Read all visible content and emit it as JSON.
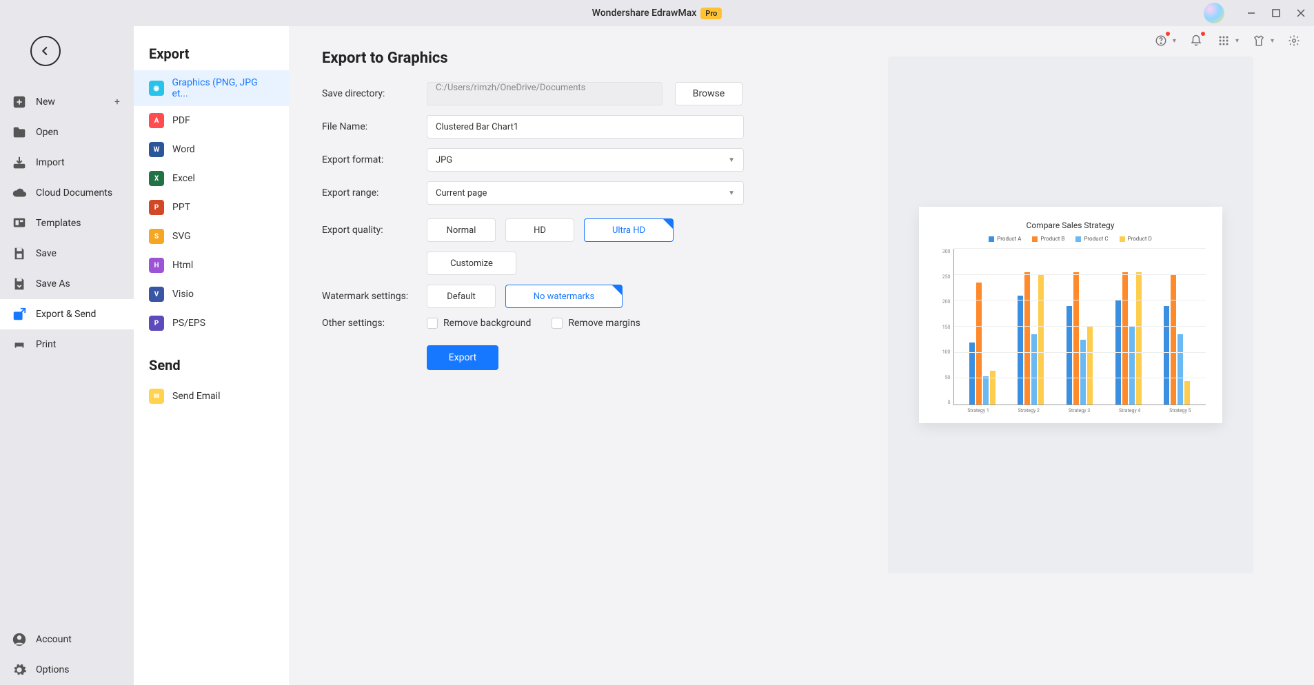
{
  "titlebar": {
    "title": "Wondershare EdrawMax",
    "badge": "Pro"
  },
  "sidebar": {
    "new": "New",
    "open": "Open",
    "import": "Import",
    "cloud": "Cloud Documents",
    "templates": "Templates",
    "save": "Save",
    "saveas": "Save As",
    "exportsend": "Export & Send",
    "print": "Print",
    "account": "Account",
    "options": "Options"
  },
  "exportPanel": {
    "heading": "Export",
    "items": {
      "graphics": "Graphics (PNG, JPG et...",
      "pdf": "PDF",
      "word": "Word",
      "excel": "Excel",
      "ppt": "PPT",
      "svg": "SVG",
      "html": "Html",
      "visio": "Visio",
      "pseps": "PS/EPS"
    },
    "sendHeading": "Send",
    "sendEmail": "Send Email"
  },
  "form": {
    "heading": "Export to Graphics",
    "saveDirLabel": "Save directory:",
    "saveDirValue": "C:/Users/rimzh/OneDrive/Documents",
    "browse": "Browse",
    "fileNameLabel": "File Name:",
    "fileNameValue": "Clustered Bar Chart1",
    "formatLabel": "Export format:",
    "formatValue": "JPG",
    "rangeLabel": "Export range:",
    "rangeValue": "Current page",
    "qualityLabel": "Export quality:",
    "qualityNormal": "Normal",
    "qualityHD": "HD",
    "qualityUltra": "Ultra HD",
    "qualityCustomize": "Customize",
    "watermarkLabel": "Watermark settings:",
    "watermarkDefault": "Default",
    "watermarkNone": "No watermarks",
    "otherLabel": "Other settings:",
    "removeBg": "Remove background",
    "removeMargins": "Remove margins",
    "exportBtn": "Export"
  },
  "chart_data": {
    "type": "bar",
    "title": "Compare Sales Strategy",
    "categories": [
      "Strategy 1",
      "Strategy 2",
      "Strategy 3",
      "Strategy 4",
      "Strategy 5"
    ],
    "series": [
      {
        "name": "Product A",
        "color": "#3a8fe0",
        "values": [
          120,
          210,
          190,
          200,
          190
        ]
      },
      {
        "name": "Product B",
        "color": "#ff8a2b",
        "values": [
          235,
          255,
          255,
          255,
          250
        ]
      },
      {
        "name": "Product C",
        "color": "#6bb9f2",
        "values": [
          55,
          135,
          125,
          150,
          135
        ]
      },
      {
        "name": "Product D",
        "color": "#ffcd4d",
        "values": [
          65,
          250,
          150,
          255,
          45
        ]
      }
    ],
    "ylabel": "",
    "xlabel": "",
    "ylim": [
      0,
      300
    ],
    "yticks": [
      0,
      50,
      100,
      150,
      200,
      250,
      300
    ]
  }
}
